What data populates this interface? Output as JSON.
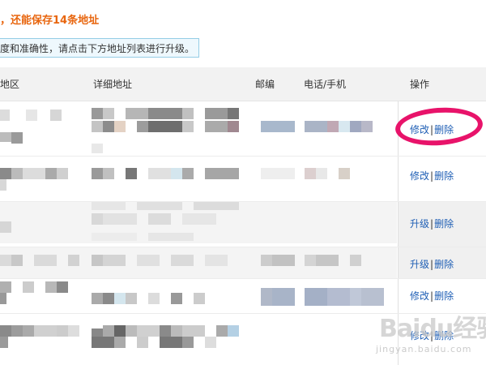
{
  "notice": {
    "title": "，还能保存14条地址",
    "tip": "度和准确性，请点击下方地址列表进行升级。"
  },
  "table": {
    "headers": {
      "region": "地区",
      "detail": "详细地址",
      "postcode": "邮编",
      "phone": "电话/手机",
      "action": "操作"
    },
    "rows": [
      {
        "actions": [
          "修改",
          "删除"
        ],
        "separator": "|"
      },
      {
        "actions": [
          "修改",
          "删除"
        ],
        "separator": "|"
      },
      {
        "actions": [
          "升级",
          "删除"
        ],
        "separator": "|"
      },
      {
        "actions": [
          "升级",
          "删除"
        ],
        "separator": "|"
      },
      {
        "actions": [
          "修改",
          "删除"
        ],
        "separator": "|"
      },
      {
        "actions": [
          "修改",
          "删除"
        ],
        "separator": "|"
      }
    ]
  },
  "colors": {
    "notice_title": "#e8660f",
    "tip_border": "#95cde6",
    "link": "#1f5fb5",
    "highlight": "#e8136a",
    "header_bg": "#f2f2f2"
  },
  "overlay": {
    "highlight_target": "first-row-actions",
    "watermark_main": "Baidu经验",
    "watermark_sub": "jingyan.baidu.com"
  }
}
